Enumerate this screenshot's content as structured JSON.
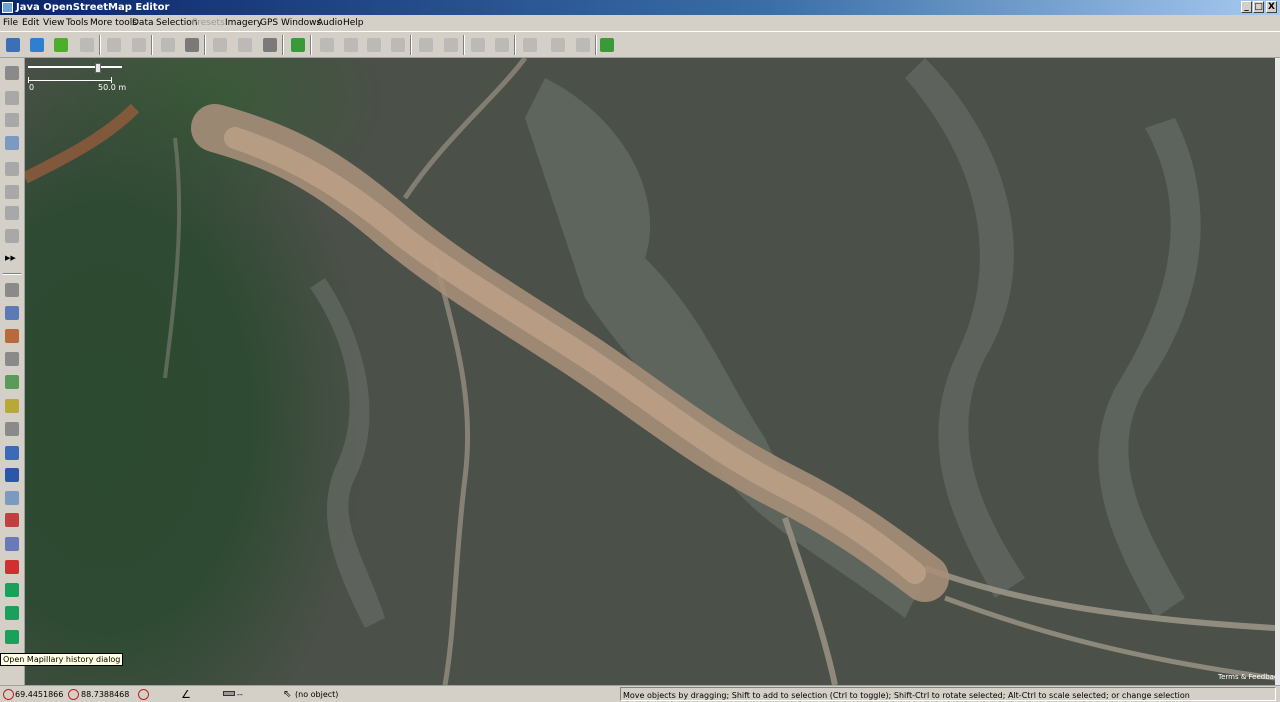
{
  "window": {
    "title": "Java OpenStreetMap Editor",
    "minimize": "_",
    "maximize": "□",
    "close": "X"
  },
  "menu": [
    {
      "label": "File",
      "enabled": true
    },
    {
      "label": "Edit",
      "enabled": true
    },
    {
      "label": "View",
      "enabled": true
    },
    {
      "label": "Tools",
      "enabled": true
    },
    {
      "label": "More tools",
      "enabled": true
    },
    {
      "label": "Data",
      "enabled": true
    },
    {
      "label": "Selection",
      "enabled": true
    },
    {
      "label": "Presets",
      "enabled": false
    },
    {
      "label": "Imagery",
      "enabled": true
    },
    {
      "label": "GPS",
      "enabled": true
    },
    {
      "label": "Windows",
      "enabled": true
    },
    {
      "label": "Audio",
      "enabled": true
    },
    {
      "label": "Help",
      "enabled": true
    }
  ],
  "toolbar": [
    {
      "name": "open-icon",
      "color": "#3b6fb6",
      "enabled": true
    },
    {
      "name": "open-location-icon",
      "color": "#2f7fd0",
      "enabled": true
    },
    {
      "name": "download-icon",
      "color": "#4caf2a",
      "enabled": true
    },
    {
      "name": "upload-icon",
      "color": "#a8a8a8",
      "enabled": false
    },
    {
      "name": "undo-icon",
      "color": "#a8a8a8",
      "enabled": false
    },
    {
      "name": "redo-icon",
      "color": "#a8a8a8",
      "enabled": false
    },
    {
      "name": "preferences-icon",
      "color": "#a8a8a8",
      "enabled": false
    },
    {
      "name": "zoom-to-data-icon",
      "color": "#7a7a7a",
      "enabled": true
    },
    {
      "name": "simplify-way-icon",
      "color": "#a8a8a8",
      "enabled": false
    },
    {
      "name": "split-way-icon",
      "color": "#a8a8a8",
      "enabled": false
    },
    {
      "name": "refresh-icon",
      "color": "#7a7a7a",
      "enabled": true
    },
    {
      "name": "tag-presets-icon",
      "color": "#3a9a3a",
      "enabled": true
    },
    {
      "name": "building-preset-icon",
      "color": "#a8a8a8",
      "enabled": false
    },
    {
      "name": "building-preset-2-icon",
      "color": "#a8a8a8",
      "enabled": false
    },
    {
      "name": "building-preset-3-icon",
      "color": "#a8a8a8",
      "enabled": false
    },
    {
      "name": "wall-preset-icon",
      "color": "#a8a8a8",
      "enabled": false
    },
    {
      "name": "car-preset-icon",
      "color": "#a8a8a8",
      "enabled": false
    },
    {
      "name": "bus-preset-icon",
      "color": "#a8a8a8",
      "enabled": false
    },
    {
      "name": "toilets-preset-icon",
      "color": "#a8a8a8",
      "enabled": false
    },
    {
      "name": "restaurant-preset-icon",
      "color": "#a8a8a8",
      "enabled": false
    },
    {
      "name": "castle-preset-icon",
      "color": "#a8a8a8",
      "enabled": false
    },
    {
      "name": "edit-preset-icon",
      "color": "#a8a8a8",
      "enabled": false
    },
    {
      "name": "factory-preset-icon",
      "color": "#a8a8a8",
      "enabled": false
    },
    {
      "name": "plugin-icon",
      "color": "#3a9a3a",
      "enabled": true
    }
  ],
  "left_tools_top": [
    {
      "name": "select-tool-icon",
      "color": "#8a8a8a"
    },
    {
      "name": "lasso-tool-icon",
      "color": "#a8a8a8"
    },
    {
      "name": "draw-tool-icon",
      "color": "#a8a8a8"
    },
    {
      "name": "zoom-tool-icon",
      "color": "#7a9ac0"
    },
    {
      "name": "delete-tool-icon",
      "color": "#a8a8a8"
    },
    {
      "name": "parallel-tool-icon",
      "color": "#a8a8a8"
    },
    {
      "name": "improve-way-tool-icon",
      "color": "#a8a8a8"
    },
    {
      "name": "extrude-tool-icon",
      "color": "#a8a8a8"
    },
    {
      "name": "more-tools-icon",
      "color": "#000000"
    }
  ],
  "left_tools_bottom": [
    {
      "name": "layers-dialog-icon",
      "color": "#8a8a8a"
    },
    {
      "name": "tags-dialog-icon",
      "color": "#5a7ab8"
    },
    {
      "name": "selection-dialog-icon",
      "color": "#b86a3a"
    },
    {
      "name": "relations-dialog-icon",
      "color": "#8a8a8a"
    },
    {
      "name": "commands-dialog-icon",
      "color": "#5a9a5a"
    },
    {
      "name": "authors-dialog-icon",
      "color": "#b8a83a"
    },
    {
      "name": "filter-dialog-icon",
      "color": "#8a8a8a"
    },
    {
      "name": "changeset-dialog-icon",
      "color": "#3a6ab8"
    },
    {
      "name": "validation-dialog-icon",
      "color": "#2a58a8"
    },
    {
      "name": "filter-funnel-icon",
      "color": "#7a9ac0"
    },
    {
      "name": "imagery-offset-icon",
      "color": "#c04040"
    },
    {
      "name": "notes-dialog-icon",
      "color": "#6a7ab8"
    },
    {
      "name": "map-marker-icon",
      "color": "#d03030"
    },
    {
      "name": "mapillary-dialog-icon",
      "color": "#1aa05a"
    },
    {
      "name": "mapillary-info-icon",
      "color": "#1aa05a"
    },
    {
      "name": "mapillary-history-icon",
      "color": "#1aa05a"
    }
  ],
  "map": {
    "scale_zero": "0",
    "scale_label": "50.0 m",
    "attribution": "Terms & Feedback"
  },
  "tooltip": "Open Mapillary history dialog",
  "status": {
    "lat": "69.4451866",
    "lon": "88.7388468",
    "heading": "",
    "angle": "",
    "distance": "--",
    "object": "(no object)",
    "help": "Move objects by dragging; Shift to add to selection (Ctrl to toggle); Shift-Ctrl to rotate selected; Alt-Ctrl to scale selected; or change selection"
  }
}
